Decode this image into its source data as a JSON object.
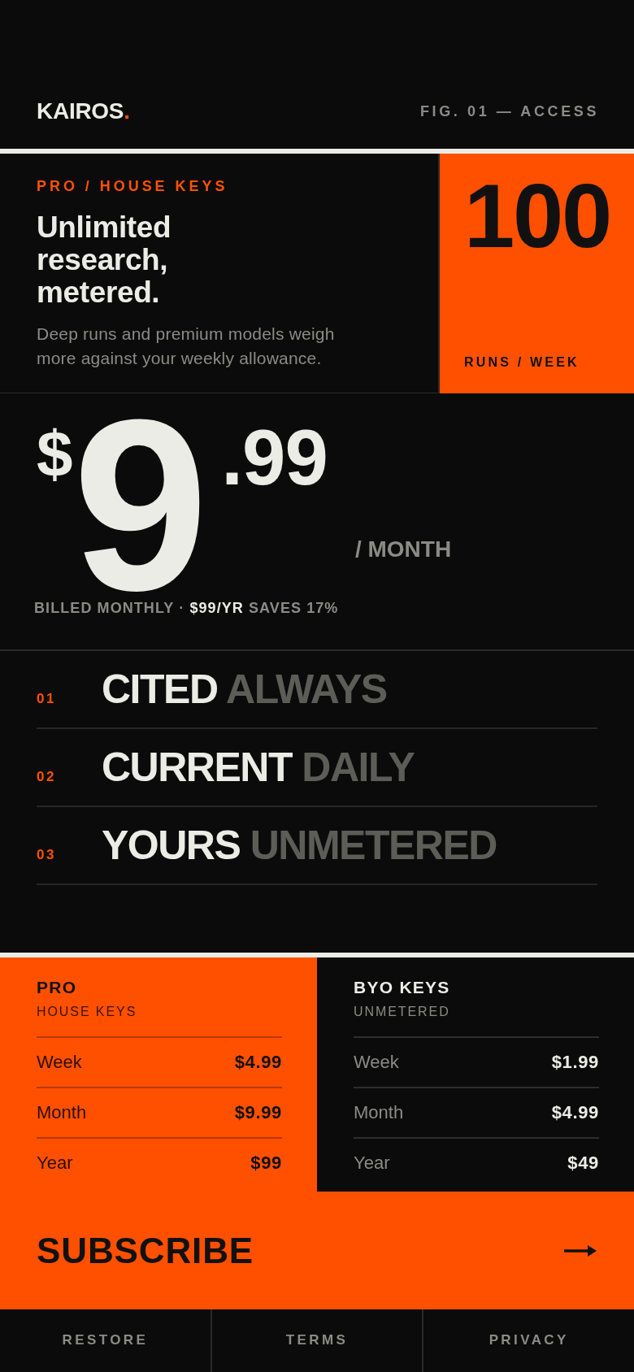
{
  "header": {
    "brand": "KAIROS",
    "brand_accent": ".",
    "figure_label": "FIG. 01 — ACCESS"
  },
  "hero": {
    "eyebrow": "PRO / HOUSE KEYS",
    "title": "Unlimited research, metered.",
    "description": "Deep runs and premium models weigh more against your weekly allowance.",
    "stat": {
      "value": "100",
      "unit": "RUNS / WEEK"
    }
  },
  "price": {
    "currency": "$",
    "whole": "9",
    "cents": ".99",
    "period": "/ MONTH",
    "note": "BILLED MONTHLY · **$99/YR** SAVES 17%"
  },
  "features": [
    {
      "number": "01",
      "primary": "CITED",
      "secondary": "ALWAYS"
    },
    {
      "number": "02",
      "primary": "CURRENT",
      "secondary": "DAILY"
    },
    {
      "number": "03",
      "primary": "YOURS",
      "secondary": "UNMETERED"
    }
  ],
  "plans": [
    {
      "name": "PRO",
      "subtitle": "HOUSE KEYS",
      "selected": true,
      "prices": [
        {
          "period": "Week",
          "price": "$4.99"
        },
        {
          "period": "Month",
          "price": "$9.99"
        },
        {
          "period": "Year",
          "price": "$99"
        }
      ]
    },
    {
      "name": "BYO KEYS",
      "subtitle": "UNMETERED",
      "selected": false,
      "prices": [
        {
          "period": "Week",
          "price": "$1.99"
        },
        {
          "period": "Month",
          "price": "$4.99"
        },
        {
          "period": "Year",
          "price": "$49"
        }
      ]
    }
  ],
  "subscribe": {
    "label": "SUBSCRIBE"
  },
  "footer_links": [
    "RESTORE",
    "TERMS",
    "PRIVACY"
  ]
}
